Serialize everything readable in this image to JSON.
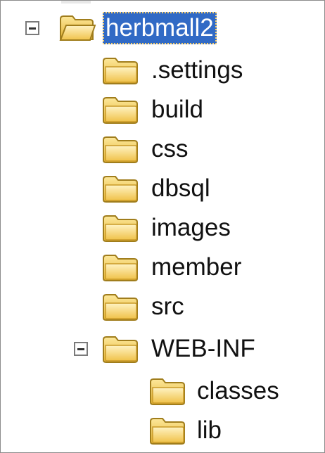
{
  "tree": {
    "root": {
      "label": "herbmall2",
      "expanded": true,
      "selected": true
    },
    "children": [
      {
        "label": ".settings"
      },
      {
        "label": "build"
      },
      {
        "label": "css"
      },
      {
        "label": "dbsql"
      },
      {
        "label": "images"
      },
      {
        "label": "member"
      },
      {
        "label": "src"
      },
      {
        "label": "WEB-INF",
        "expanded": true,
        "children": [
          {
            "label": "classes"
          },
          {
            "label": "lib"
          }
        ]
      }
    ]
  },
  "colors": {
    "selection": "#316ac5",
    "folder_fill": "#f6cf55",
    "folder_edge": "#b08a20"
  },
  "icons": {
    "collapse": "minus-box-icon",
    "folder": "folder-icon",
    "open_folder": "open-folder-icon"
  }
}
